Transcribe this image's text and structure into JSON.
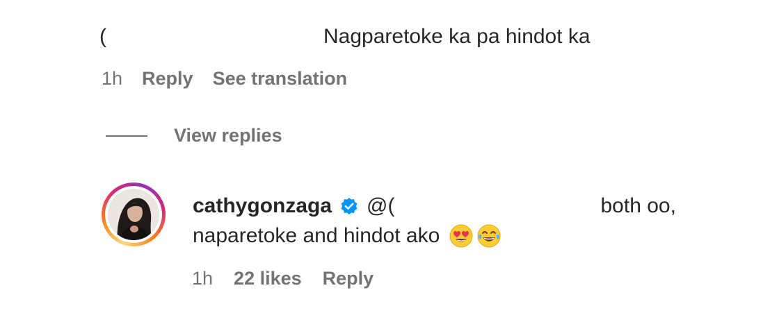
{
  "comment": {
    "username_partial": "(",
    "text": "Nagparetoke ka pa hindot ka",
    "time": "1h",
    "reply_label": "Reply",
    "translation_label": "See translation"
  },
  "view_replies": {
    "label": "View replies"
  },
  "reply": {
    "username": "cathygonzaga",
    "verified": true,
    "mention_partial": "@(",
    "text_line1": "both oo,",
    "text_line2": "naparetoke and hindot ako",
    "emojis": [
      "heart-eyes-emoji",
      "tears-of-joy-emoji"
    ],
    "time": "1h",
    "likes": "22 likes",
    "reply_label": "Reply"
  },
  "colors": {
    "text_primary": "#262626",
    "text_secondary": "#737373",
    "verified_blue": "#0095f6"
  }
}
